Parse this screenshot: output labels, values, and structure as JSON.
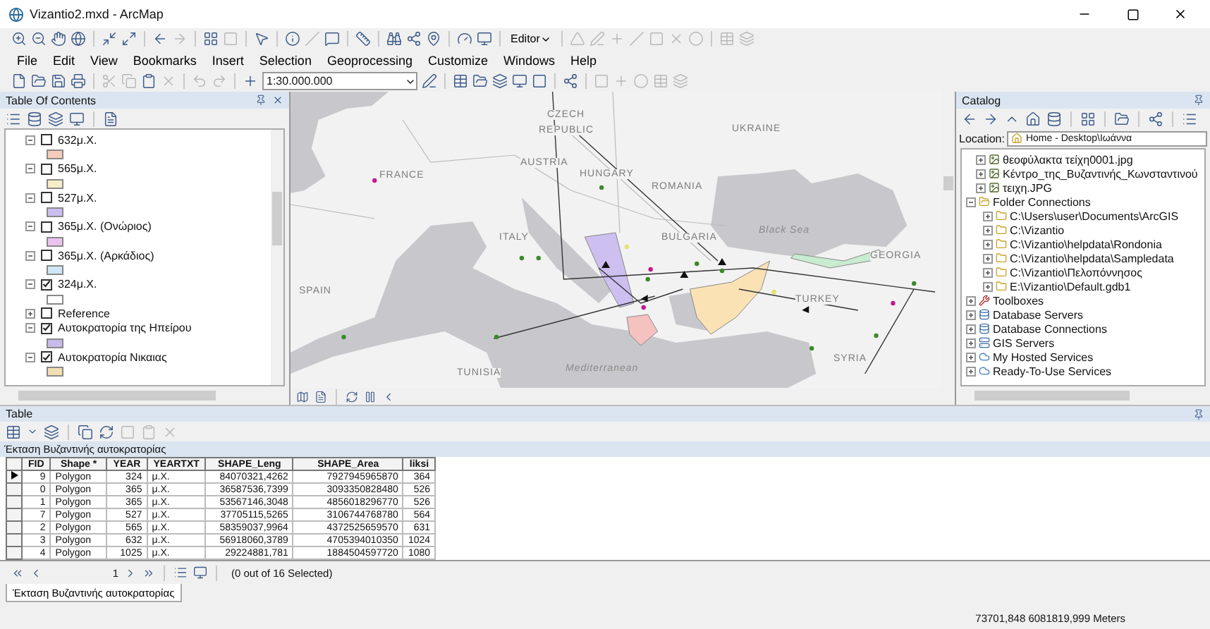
{
  "window": {
    "title": "Vizantio2.mxd - ArcMap"
  },
  "toolbar": {
    "editor_label": "Editor",
    "scale": "1:30.000.000"
  },
  "menu": [
    "File",
    "Edit",
    "View",
    "Bookmarks",
    "Insert",
    "Selection",
    "Geoprocessing",
    "Customize",
    "Windows",
    "Help"
  ],
  "toc": {
    "title": "Table Of Contents",
    "layers": [
      {
        "label": "632μ.Χ.",
        "checked": false,
        "expanded": true,
        "color": "#f6cbb9"
      },
      {
        "label": "565μ.Χ.",
        "checked": false,
        "expanded": true,
        "color": "#f5edc6"
      },
      {
        "label": "527μ.Χ.",
        "checked": false,
        "expanded": true,
        "color": "#cbbdf0"
      },
      {
        "label": "365μ.Χ. (Ονώριος)",
        "checked": false,
        "expanded": true,
        "color": "#eac3ef"
      },
      {
        "label": "365μ.Χ. (Αρκάδιος)",
        "checked": false,
        "expanded": true,
        "color": "#cfe7f6"
      },
      {
        "label": "324μ.Χ.",
        "checked": true,
        "expanded": true,
        "color": "#ffffff"
      },
      {
        "label": "Reference",
        "checked": false,
        "expanded": false
      },
      {
        "label": "Αυτοκρατορία της Ηπείρου",
        "checked": true,
        "expanded": true,
        "color": "#c9bbe9"
      },
      {
        "label": "Αυτοκρατορία Νικαιας",
        "checked": true,
        "expanded": true,
        "color": "#f2dfb5"
      }
    ]
  },
  "map": {
    "labels": [
      {
        "text": "FRANCE",
        "kind": "country"
      },
      {
        "text": "CZECH",
        "kind": "country"
      },
      {
        "text": "REPUBLIC",
        "kind": "country"
      },
      {
        "text": "AUSTRIA",
        "kind": "country"
      },
      {
        "text": "HUNGARY",
        "kind": "country"
      },
      {
        "text": "ROMANIA",
        "kind": "country"
      },
      {
        "text": "UKRAINE",
        "kind": "country"
      },
      {
        "text": "ITALY",
        "kind": "country"
      },
      {
        "text": "BULGARIA",
        "kind": "country"
      },
      {
        "text": "Black Sea",
        "kind": "sea"
      },
      {
        "text": "GEORGIA",
        "kind": "country"
      },
      {
        "text": "SPAIN",
        "kind": "country"
      },
      {
        "text": "TURKEY",
        "kind": "country"
      },
      {
        "text": "TUNISIA",
        "kind": "country"
      },
      {
        "text": "Mediterranean",
        "kind": "sea"
      },
      {
        "text": "SYRIA",
        "kind": "country"
      }
    ]
  },
  "catalog": {
    "title": "Catalog",
    "location_label": "Location:",
    "location": "Home - Desktop\\Ιωάννα",
    "partial_items": [
      {
        "label": "θεοφύλακτα τείχη0001.jpg",
        "kind": "raster",
        "expanded": false
      },
      {
        "label": "Κέντρο_της_Βυζαντινής_Κωνσταντινού",
        "kind": "raster",
        "expanded": false
      },
      {
        "label": "τειχη.JPG",
        "kind": "raster",
        "expanded": false
      }
    ],
    "tree": [
      {
        "label": "Folder Connections",
        "kind": "folder-connections",
        "expanded": true,
        "children": [
          {
            "label": "C:\\Users\\user\\Documents\\ArcGIS",
            "kind": "folder",
            "expanded": false
          },
          {
            "label": "C:\\Vizantio",
            "kind": "folder",
            "expanded": false
          },
          {
            "label": "C:\\Vizantio\\helpdata\\Rondonia",
            "kind": "folder",
            "expanded": false
          },
          {
            "label": "C:\\Vizantio\\helpdata\\Sampledata",
            "kind": "folder",
            "expanded": false
          },
          {
            "label": "C:\\Vizantio\\Πελοπόννησος",
            "kind": "folder",
            "expanded": false
          },
          {
            "label": "E:\\Vizantio\\Default.gdb1",
            "kind": "folder",
            "expanded": false
          }
        ]
      },
      {
        "label": "Toolboxes",
        "kind": "toolbox",
        "expanded": false
      },
      {
        "label": "Database Servers",
        "kind": "database",
        "expanded": false
      },
      {
        "label": "Database Connections",
        "kind": "database",
        "expanded": false
      },
      {
        "label": "GIS Servers",
        "kind": "server",
        "expanded": false
      },
      {
        "label": "My Hosted Services",
        "kind": "cloud",
        "expanded": false
      },
      {
        "label": "Ready-To-Use Services",
        "kind": "cloud",
        "expanded": false
      }
    ]
  },
  "table": {
    "title": "Table",
    "name": "Έκταση Βυζαντινής αυτοκρατορίας",
    "columns": [
      "FID",
      "Shape *",
      "YEAR",
      "YEARTXT",
      "SHAPE_Leng",
      "SHAPE_Area",
      "liksi"
    ],
    "rows": [
      {
        "current": true,
        "cells": [
          "9",
          "Polygon",
          "324",
          "μ.Χ.",
          "84070321,4262",
          "7927945965870",
          "364"
        ]
      },
      {
        "current": false,
        "cells": [
          "0",
          "Polygon",
          "365",
          "μ.Χ.",
          "36587536,7399",
          "3093350828480",
          "526"
        ]
      },
      {
        "current": false,
        "cells": [
          "1",
          "Polygon",
          "365",
          "μ.Χ.",
          "53567146,3048",
          "4856018296770",
          "526"
        ]
      },
      {
        "current": false,
        "cells": [
          "7",
          "Polygon",
          "527",
          "μ.Χ.",
          "37705115,5265",
          "3106744768780",
          "564"
        ]
      },
      {
        "current": false,
        "cells": [
          "2",
          "Polygon",
          "565",
          "μ.Χ.",
          "58359037,9964",
          "4372525659570",
          "631"
        ]
      },
      {
        "current": false,
        "cells": [
          "3",
          "Polygon",
          "632",
          "μ.Χ.",
          "56918060,3789",
          "4705394010350",
          "1024"
        ]
      },
      {
        "current": false,
        "cells": [
          "4",
          "Polygon",
          "1025",
          "μ.Χ.",
          "29224881,781",
          "1884504597720",
          "1080"
        ]
      }
    ],
    "record": "1",
    "selection": "(0 out of 16 Selected)",
    "tabs": [
      {
        "label": "Έκταση Βυζαντινής αυτοκρατορίας",
        "selected": true
      }
    ]
  },
  "status_bar": {
    "coordinates": "73701,848  6081819,999 Meters"
  }
}
